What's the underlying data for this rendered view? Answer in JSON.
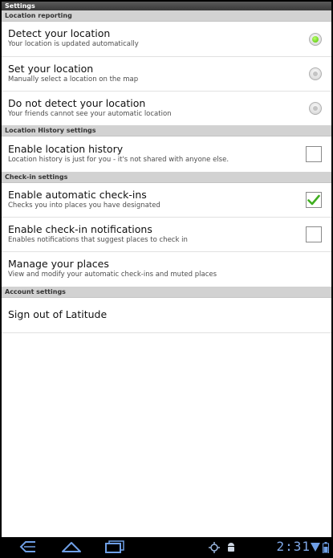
{
  "title": "Settings",
  "sections": {
    "location_reporting": {
      "header": "Location reporting",
      "detect": {
        "title": "Detect your location",
        "sub": "Your location is updated automatically",
        "selected": true
      },
      "set": {
        "title": "Set your location",
        "sub": "Manually select a location on the map",
        "selected": false
      },
      "nodetect": {
        "title": "Do not detect your location",
        "sub": "Your friends cannot see your automatic location",
        "selected": false
      }
    },
    "history": {
      "header": "Location History settings",
      "enable": {
        "title": "Enable location history",
        "sub": "Location history is just for you - it's not shared with anyone else.",
        "checked": false
      }
    },
    "checkin": {
      "header": "Check-in settings",
      "auto": {
        "title": "Enable automatic check-ins",
        "sub": "Checks you into places you have designated",
        "checked": true
      },
      "notify": {
        "title": "Enable check-in notifications",
        "sub": "Enables notifications that suggest places to check in",
        "checked": false
      },
      "manage": {
        "title": "Manage your places",
        "sub": "View and modify your automatic check-ins and muted places"
      }
    },
    "account": {
      "header": "Account settings",
      "signout": {
        "title": "Sign out of Latitude"
      }
    }
  },
  "status_bar": {
    "time": "2:31",
    "icons": [
      "back-icon",
      "home-icon",
      "recent-apps-icon",
      "location-icon",
      "android-debug-icon",
      "wifi-icon",
      "battery-icon"
    ],
    "accent_color": "#6f9fe6"
  },
  "colors": {
    "radio_selected": "#4fbf00",
    "checkmark": "#3fae1f",
    "section_header": "#d2d2d2"
  }
}
